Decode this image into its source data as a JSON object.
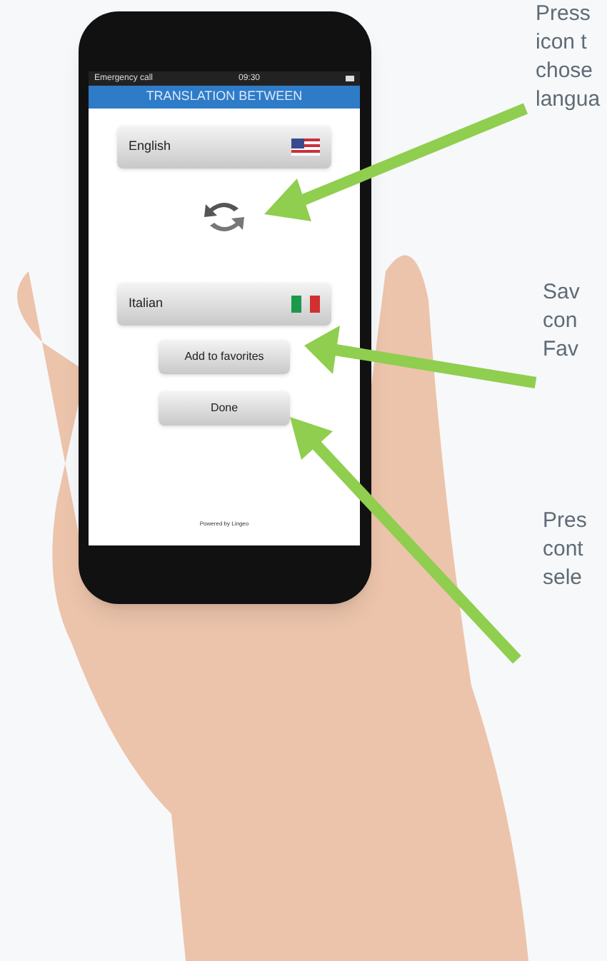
{
  "status_bar": {
    "carrier": "Emergency call",
    "time": "09:30"
  },
  "header": {
    "title": "TRANSLATION BETWEEN"
  },
  "languages": [
    {
      "name": "English",
      "kind": "us"
    },
    {
      "name": "Italian",
      "kind": "it"
    }
  ],
  "buttons": [
    "Add to favorites",
    "Done"
  ],
  "footer": "Powered by Lingeo",
  "annotations": [
    {
      "lines": [
        "Press",
        "icon t",
        "chose",
        "langua"
      ]
    },
    {
      "lines": [
        "Sav",
        "con",
        "Fav"
      ]
    },
    {
      "lines": [
        "Pres",
        "cont",
        "sele"
      ]
    }
  ]
}
